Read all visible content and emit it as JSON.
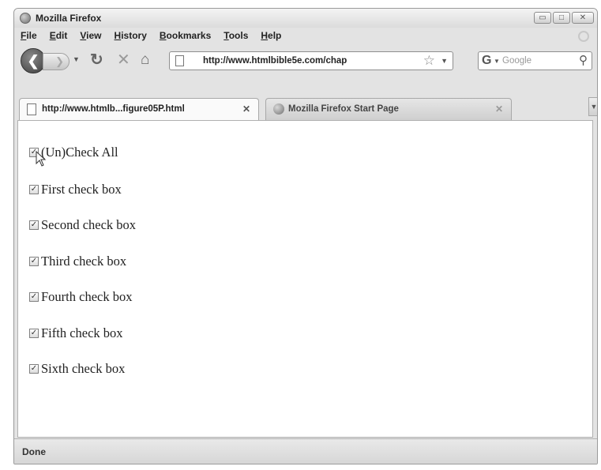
{
  "window": {
    "title": "Mozilla Firefox",
    "controls": {
      "minimize": "▭",
      "maximize": "□",
      "close": "✕"
    }
  },
  "menubar": {
    "items": [
      "File",
      "Edit",
      "View",
      "History",
      "Bookmarks",
      "Tools",
      "Help"
    ]
  },
  "toolbar": {
    "back_icon": "back-arrow-icon",
    "forward_icon": "forward-arrow-icon",
    "reload_icon": "reload-icon",
    "stop_icon": "stop-icon",
    "home_icon": "home-icon"
  },
  "urlbar": {
    "value": "http://www.htmlbible5e.com/chap"
  },
  "search": {
    "engine": "G",
    "placeholder": "Google"
  },
  "tabs": [
    {
      "label": "http://www.htmlb...figure05P.html",
      "active": true
    },
    {
      "label": "Mozilla Firefox Start Page",
      "active": false
    }
  ],
  "page": {
    "checkboxes": [
      {
        "label": "(Un)Check All",
        "checked": true
      },
      {
        "label": "First check box",
        "checked": true
      },
      {
        "label": "Second check box",
        "checked": true
      },
      {
        "label": "Third check box",
        "checked": true
      },
      {
        "label": "Fourth check box",
        "checked": true
      },
      {
        "label": "Fifth check box",
        "checked": true
      },
      {
        "label": "Sixth check box",
        "checked": true
      }
    ]
  },
  "status": {
    "text": "Done"
  }
}
